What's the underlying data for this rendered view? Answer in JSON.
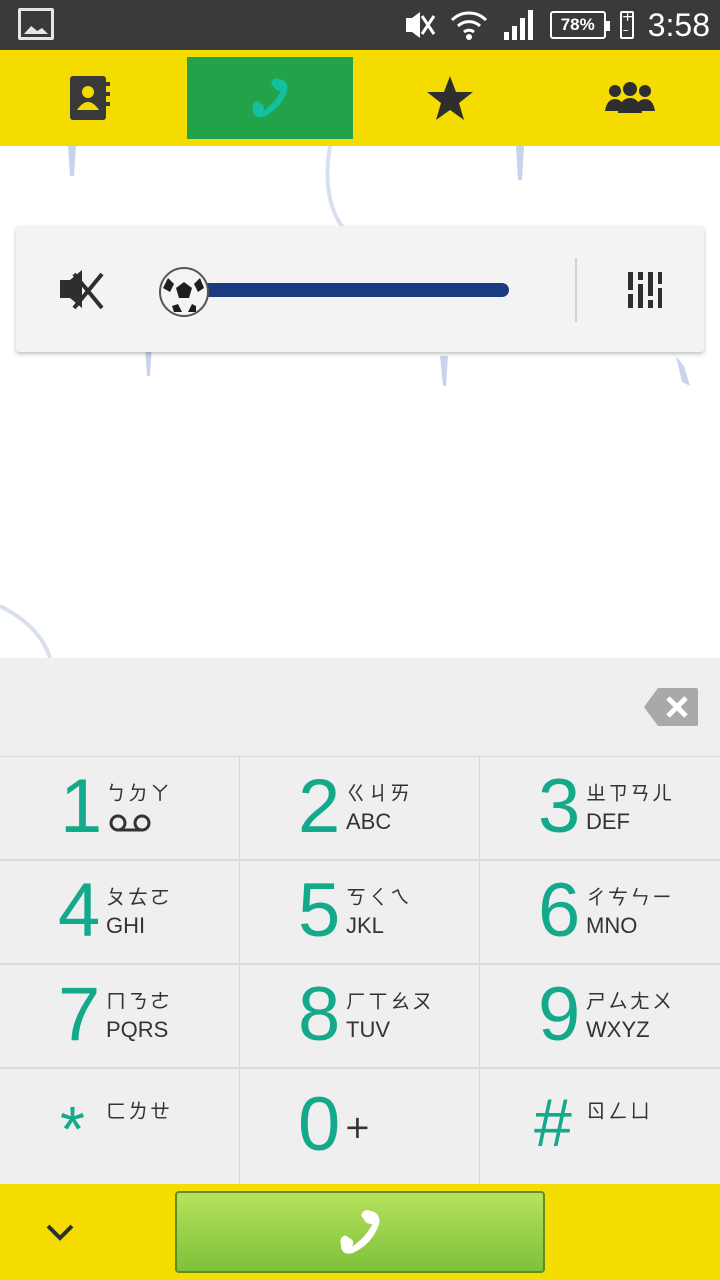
{
  "status_bar": {
    "time": "3:58",
    "battery_percent": "78%",
    "icons": [
      "gallery-icon",
      "vibrate-off-icon",
      "wifi-icon",
      "signal-icon",
      "battery-icon"
    ]
  },
  "tabs": [
    {
      "icon": "contacts-icon",
      "active": false
    },
    {
      "icon": "phone-icon",
      "active": true
    },
    {
      "icon": "star-icon",
      "active": false
    },
    {
      "icon": "groups-icon",
      "active": false
    }
  ],
  "volume_control": {
    "icons": [
      "mute-icon",
      "soccer-ball-icon",
      "equalizer-icon"
    ],
    "level": 0
  },
  "keypad": {
    "keys": [
      {
        "digit": "1",
        "sub": "ㄅㄉㄚ",
        "alpha": ""
      },
      {
        "digit": "2",
        "sub": "ㄍㄐㄞ",
        "alpha": "ABC"
      },
      {
        "digit": "3",
        "sub": "ㄓㄗㄢㄦ",
        "alpha": "DEF"
      },
      {
        "digit": "4",
        "sub": "ㄆㄊㄛ",
        "alpha": "GHI"
      },
      {
        "digit": "5",
        "sub": "ㄎㄑㄟ",
        "alpha": "JKL"
      },
      {
        "digit": "6",
        "sub": "ㄔㄘㄣㄧ",
        "alpha": "MNO"
      },
      {
        "digit": "7",
        "sub": "ㄇㄋㄜ",
        "alpha": "PQRS"
      },
      {
        "digit": "8",
        "sub": "ㄏㄒㄠㄡ",
        "alpha": "TUV"
      },
      {
        "digit": "9",
        "sub": "ㄕㄙㄤㄨ",
        "alpha": "WXYZ"
      },
      {
        "digit": "*",
        "sub": "ㄈㄌㄝ",
        "alpha": ""
      },
      {
        "digit": "0",
        "sub": "+",
        "alpha": ""
      },
      {
        "digit": "#",
        "sub": "ㄖㄥㄩ",
        "alpha": ""
      }
    ]
  },
  "colors": {
    "accent_yellow": "#f5dc00",
    "active_tab_green": "#22a34a",
    "digit_teal": "#14a98a",
    "call_button_green": "#8fcd45",
    "slider_blue": "#1b3a82"
  }
}
